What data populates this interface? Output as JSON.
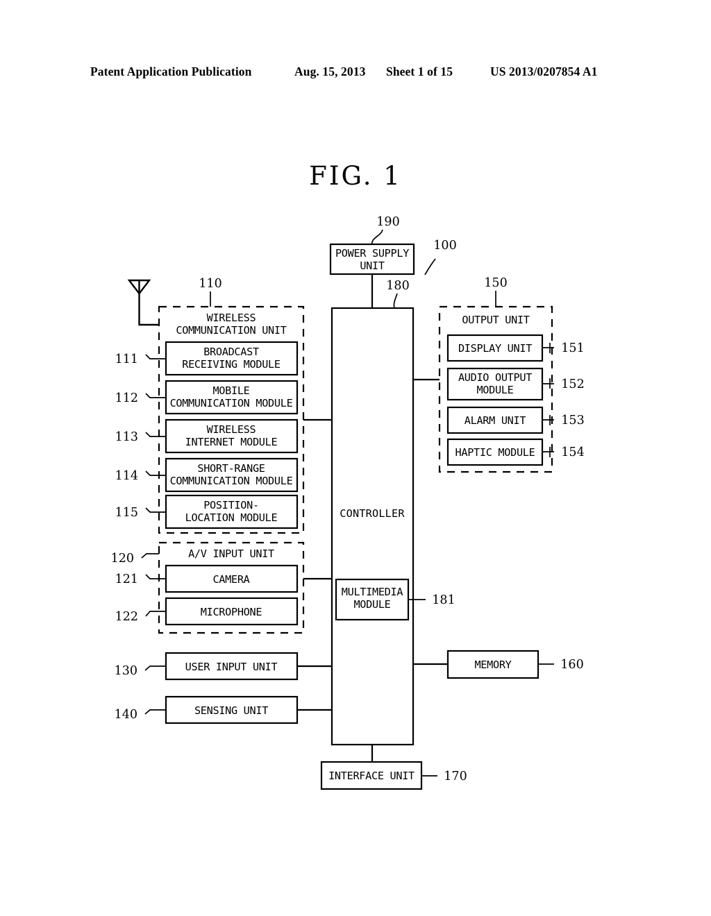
{
  "header": {
    "publication": "Patent Application Publication",
    "date": "Aug. 15, 2013",
    "sheet": "Sheet 1 of 15",
    "patent_number": "US 2013/0207854 A1"
  },
  "figure": {
    "title": "FIG.  1",
    "system_ref": "100"
  },
  "blocks": {
    "power_supply": {
      "label_line1": "POWER  SUPPLY",
      "label_line2": "UNIT",
      "ref": "190"
    },
    "controller": {
      "label": "CONTROLLER",
      "ref": "180"
    },
    "multimedia": {
      "label_line1": "MULTIMEDIA",
      "label_line2": "MODULE",
      "ref": "181"
    },
    "memory": {
      "label": "MEMORY",
      "ref": "160"
    },
    "interface": {
      "label": "INTERFACE UNIT",
      "ref": "170"
    },
    "user_input": {
      "label": "USER INPUT UNIT",
      "ref": "130"
    },
    "sensing": {
      "label": "SENSING UNIT",
      "ref": "140"
    }
  },
  "wireless_unit": {
    "title_line1": "WIRELESS",
    "title_line2": "COMMUNICATION UNIT",
    "ref": "110",
    "modules": [
      {
        "line1": "BROADCAST",
        "line2": "RECEIVING MODULE",
        "ref": "111"
      },
      {
        "line1": "MOBILE",
        "line2": "COMMUNICATION MODULE",
        "ref": "112"
      },
      {
        "line1": "WIRELESS",
        "line2": "INTERNET MODULE",
        "ref": "113"
      },
      {
        "line1": "SHORT-RANGE",
        "line2": "COMMUNICATION MODULE",
        "ref": "114"
      },
      {
        "line1": "POSITION-",
        "line2": "LOCATION MODULE",
        "ref": "115"
      }
    ]
  },
  "av_input_unit": {
    "title": "A/V INPUT UNIT",
    "ref": "120",
    "modules": [
      {
        "label": "CAMERA",
        "ref": "121"
      },
      {
        "label": "MICROPHONE",
        "ref": "122"
      }
    ]
  },
  "output_unit": {
    "title": "OUTPUT UNIT",
    "ref": "150",
    "modules": [
      {
        "line1": "DISPLAY UNIT",
        "line2": "",
        "ref": "151"
      },
      {
        "line1": "AUDIO OUTPUT",
        "line2": "MODULE",
        "ref": "152"
      },
      {
        "line1": "ALARM UNIT",
        "line2": "",
        "ref": "153"
      },
      {
        "line1": "HAPTIC MODULE",
        "line2": "",
        "ref": "154"
      }
    ]
  },
  "icons": {
    "antenna": "antenna-icon"
  }
}
